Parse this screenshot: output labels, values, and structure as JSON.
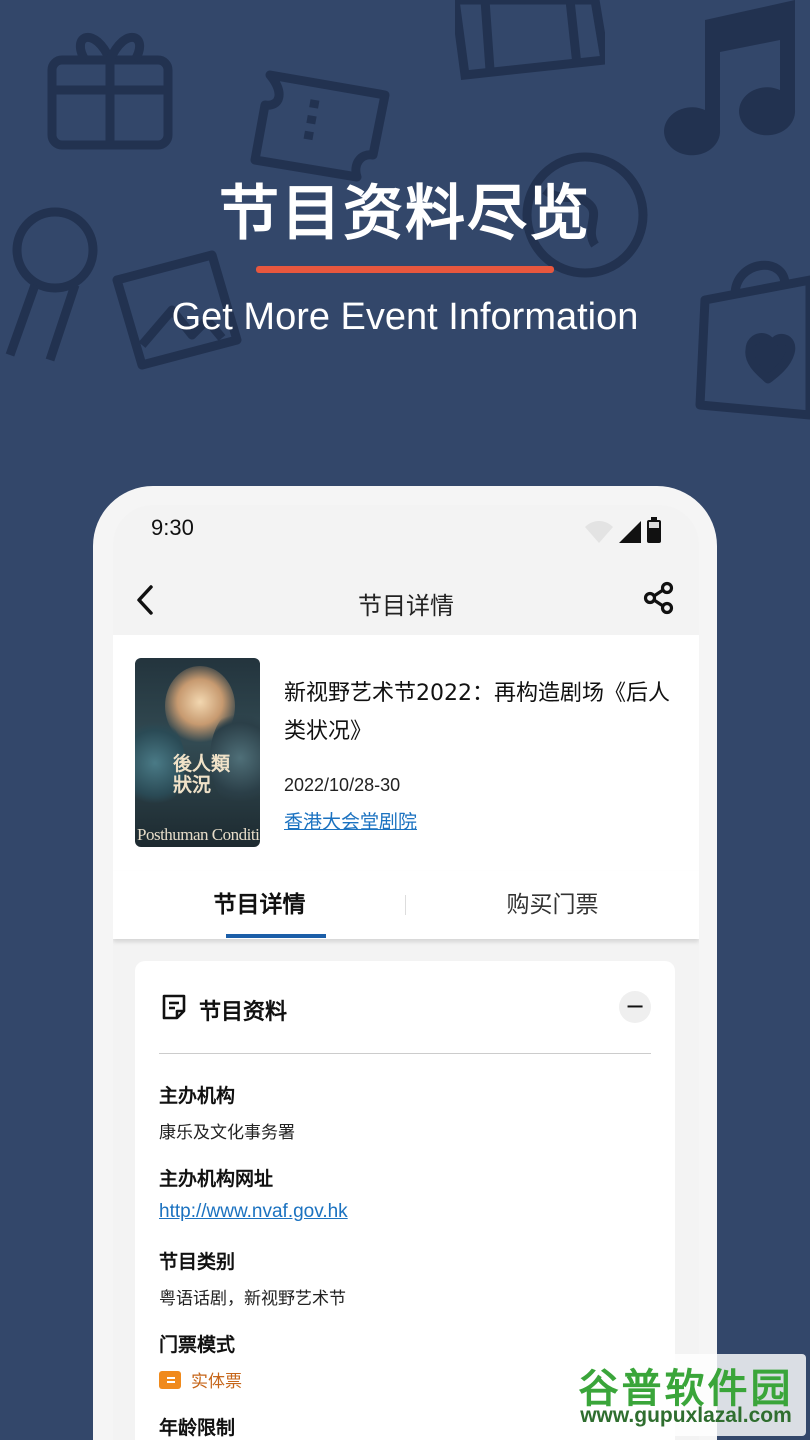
{
  "promo": {
    "title": "节目资料尽览",
    "subtitle": "Get More Event Information",
    "accent_color": "#e8573e",
    "background_color": "#33476a"
  },
  "status_bar": {
    "time": "9:30",
    "icons": [
      "wifi-icon",
      "signal-icon",
      "battery-icon"
    ]
  },
  "app_bar": {
    "title": "节目详情",
    "back_icon": "chevron-left-icon",
    "share_icon": "share-icon"
  },
  "event": {
    "poster": {
      "title_lines": [
        "後人類",
        "狀況"
      ],
      "footer": "Posthuman Condition"
    },
    "title": "新视野艺术节2022：再构造剧场《后人类状况》",
    "date": "2022/10/28-30",
    "venue": "香港大会堂剧院"
  },
  "tabs": [
    {
      "label": "节目详情",
      "active": true
    },
    {
      "label": "购买门票",
      "active": false
    }
  ],
  "info_card": {
    "title": "节目资料",
    "collapse_symbol": "−",
    "fields": [
      {
        "label": "主办机构",
        "value": "康乐及文化事务署"
      },
      {
        "label": "主办机构网址",
        "value": "http://www.nvaf.gov.hk"
      },
      {
        "label": "节目类别",
        "value": "粤语话剧，新视野艺术节"
      },
      {
        "label": "门票模式",
        "value": "实体票"
      },
      {
        "label": "年龄限制",
        "value": ""
      }
    ]
  },
  "watermark": {
    "name": "谷普软件园",
    "url": "www.gupuxlazal.com"
  }
}
